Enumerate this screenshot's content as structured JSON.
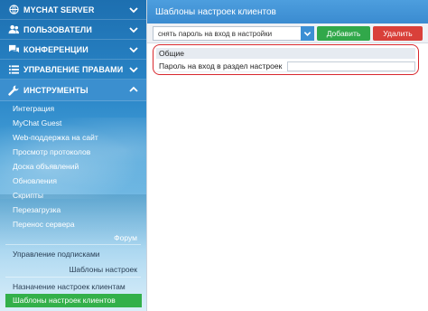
{
  "sidebar": {
    "menu": [
      {
        "label": "MYCHAT SERVER",
        "icon": "globe-icon"
      },
      {
        "label": "ПОЛЬЗОВАТЕЛИ",
        "icon": "users-icon"
      },
      {
        "label": "КОНФЕРЕНЦИИ",
        "icon": "chat-icon"
      },
      {
        "label": "УПРАВЛЕНИЕ ПРАВАМИ",
        "icon": "list-icon"
      },
      {
        "label": "ИНСТРУМЕНТЫ",
        "icon": "wrench-icon"
      }
    ],
    "tools_items": [
      "Интеграция",
      "MyChat Guest",
      "Web-поддержка на сайт",
      "Просмотр протоколов",
      "Доска объявлений",
      "Обновления",
      "Скрипты",
      "Перезагрузка",
      "Перенос сервера"
    ],
    "group_forum": "Форум",
    "forum_items": [
      "Управление подписками"
    ],
    "group_templates": "Шаблоны настроек",
    "template_items": [
      "Назначение настроек клиентам",
      "Шаблоны настроек клиентов"
    ]
  },
  "header": {
    "title": "Шаблоны настроек клиентов"
  },
  "toolbar": {
    "select_value": "снять пароль на вход в настройки",
    "add_label": "Добавить",
    "delete_label": "Удалить"
  },
  "panel": {
    "section": "Общие",
    "row_label": "Пароль на вход в раздел настроек",
    "row_value": ""
  },
  "colors": {
    "accent": "#3a8bd0",
    "add": "#31a84a",
    "delete": "#d9403a",
    "selected": "#33b04a",
    "highlight": "#d8282e"
  }
}
